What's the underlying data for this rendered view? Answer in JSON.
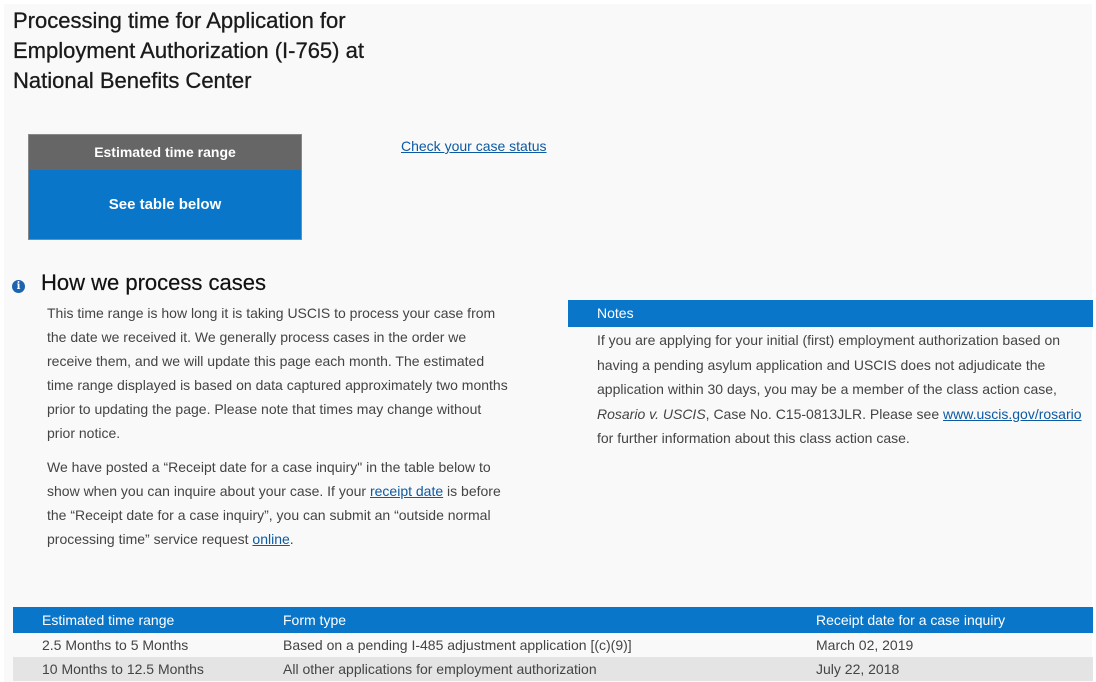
{
  "page_title": "Processing time for Application for Employment Authorization (I-765) at National Benefits Center",
  "range_card": {
    "header": "Estimated time range",
    "value": "See table below"
  },
  "check_status_link": "Check your case status",
  "how_we_process": {
    "heading": "How we process cases",
    "paragraph1": "This time range is how long it is taking USCIS to process your case from the date we received it. We generally process cases in the order we receive them, and we will update this page each month. The estimated time range displayed is based on data captured approximately two months prior to updating the page. Please note that times may change without prior notice.",
    "paragraph2_part1": "We have posted a “Receipt date for a case inquiry\" in the table below to show when you can inquire about your case. If your",
    "receipt_date_link": "receipt date",
    "paragraph2_part2": "is before the “Receipt date for a case inquiry”, you can submit an “outside normal processing time” service request",
    "online_link": "online",
    "paragraph2_end": "."
  },
  "notes": {
    "header": "Notes",
    "text_part1": "If you are applying for your initial (first) employment authorization based on having a pending asylum application and USCIS does not adjudicate the application within 30 days, you may be a member of the class action case,",
    "case_name": "Rosario v. USCIS",
    "text_part2": ", Case No. C15-0813JLR. Please see",
    "link": "www.uscis.gov/rosario",
    "text_part3": "for further information about this class action case."
  },
  "table": {
    "headers": [
      "Estimated time range",
      "Form type",
      "Receipt date for a case inquiry"
    ],
    "rows": [
      [
        "2.5 Months to 5 Months",
        "Based on a pending I-485 adjustment application [(c)(9)]",
        "March 02, 2019"
      ],
      [
        "10 Months to 12.5 Months",
        "All other applications for employment authorization",
        "July 22, 2018"
      ]
    ]
  },
  "colors": {
    "accent_blue": "#0a76c9",
    "card_header_gray": "#666666",
    "link_blue": "#0d5aa3",
    "alt_row_gray": "#e4e4e4"
  },
  "icons": {
    "section_icon": "info-icon"
  }
}
